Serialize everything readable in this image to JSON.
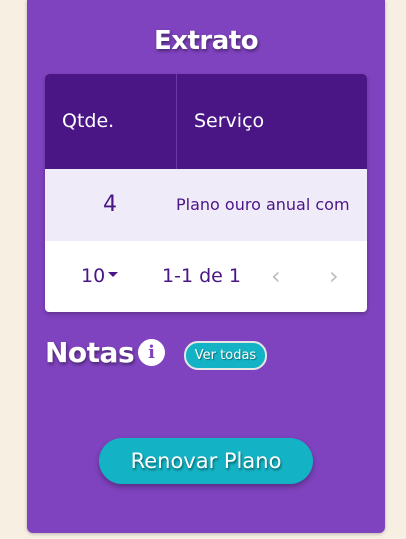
{
  "colors": {
    "page_background": "#f6efe2",
    "card_purple": "#7f43bf",
    "header_dark_purple": "#4a1686",
    "row_lavender": "#f0ebf9",
    "accent_teal": "#13b3c5"
  },
  "extrato": {
    "title": "Extrato",
    "columns": [
      "Qtde.",
      "Serviço"
    ],
    "rows": [
      {
        "qty": "4",
        "service": "Plano ouro anual com"
      }
    ],
    "pagination": {
      "page_size": "10",
      "range": "1-1 de 1",
      "prev_icon": "chevron-left-icon",
      "next_icon": "chevron-right-icon"
    }
  },
  "notas": {
    "title": "Notas",
    "info_icon": "info-icon",
    "view_all_label": "Ver todas"
  },
  "actions": {
    "renew_label": "Renovar Plano"
  }
}
